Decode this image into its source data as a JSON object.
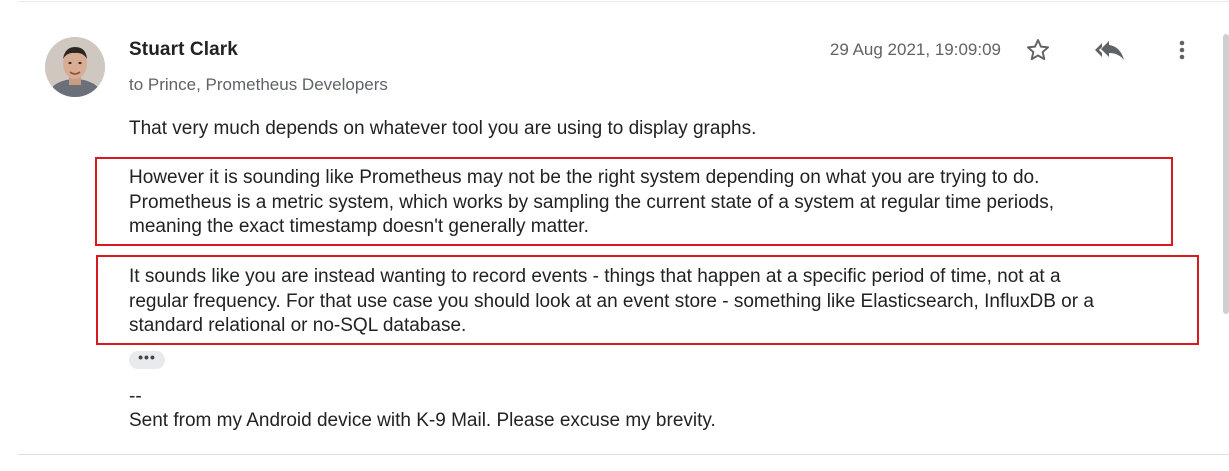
{
  "message": {
    "sender": "Stuart Clark",
    "recipients": "to Prince, Prometheus Developers",
    "timestamp": "29 Aug 2021, 19:09:09",
    "paragraphs": [
      {
        "lines": [
          "That very much depends on whatever tool you are using to display graphs."
        ]
      },
      {
        "lines": [
          "However it is sounding like Prometheus may not be the right system depending on what you are trying to do.",
          "Prometheus is a metric system, which works by sampling the current state of a system at regular time periods,",
          "meaning the exact timestamp doesn't generally matter."
        ]
      },
      {
        "lines": [
          "It sounds like you are instead wanting to record events - things that happen at a specific period of time, not at a",
          "regular frequency. For that use case you should look at an event store - something like Elasticsearch, InfluxDB or a",
          "standard relational or no-SQL database."
        ]
      }
    ],
    "show_trimmed_label": "•••",
    "signature": {
      "dash": "--",
      "text": "Sent from my Android device with K-9 Mail. Please excuse my brevity."
    }
  },
  "icons": {
    "star": "star-icon",
    "reply_all": "reply-all-icon",
    "more": "more-vert-icon",
    "avatar": "avatar"
  },
  "colors": {
    "highlight_border": "#d71920",
    "secondary_text": "#5f6368"
  }
}
